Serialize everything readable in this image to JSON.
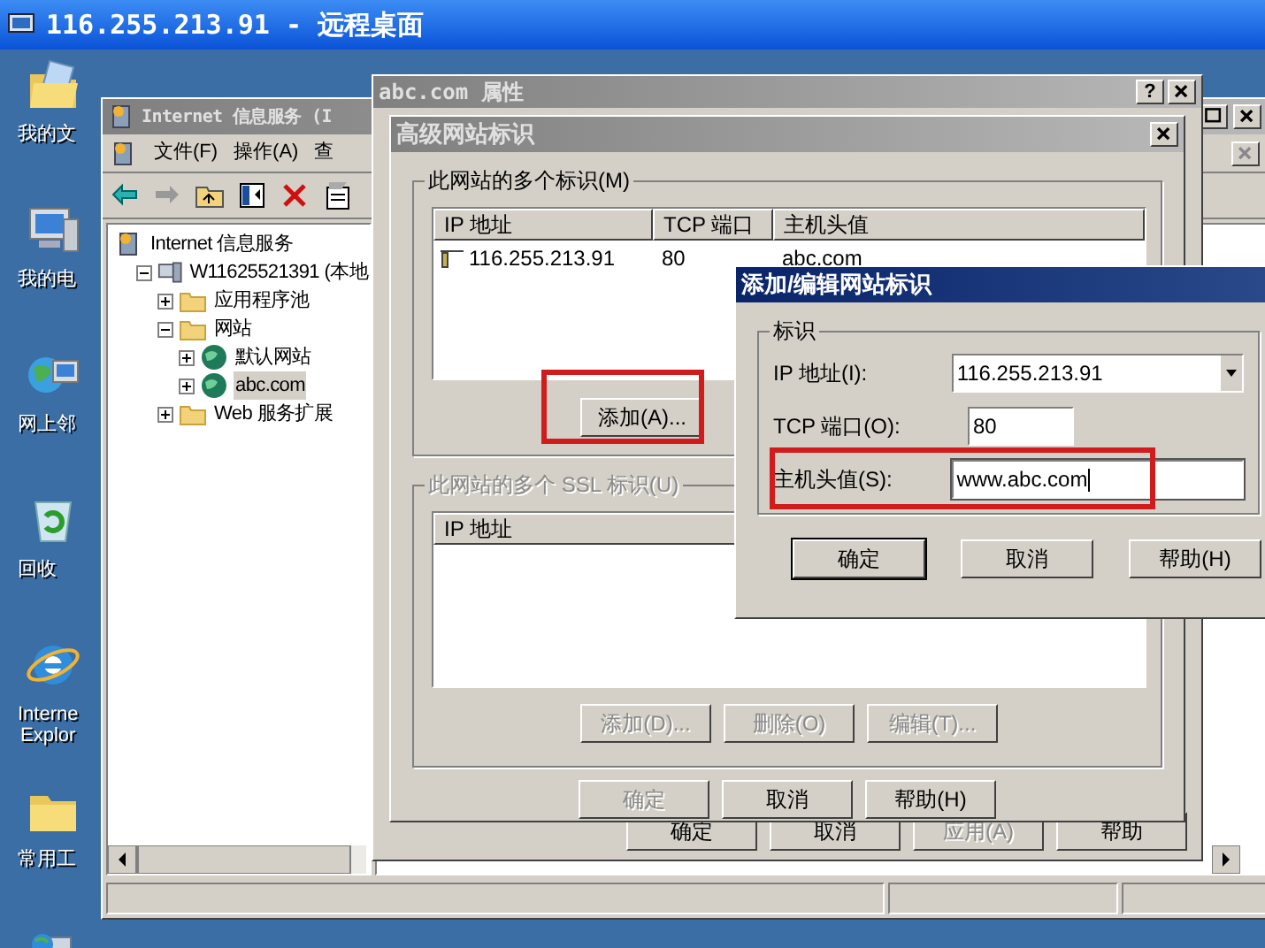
{
  "remote_window": {
    "title": "116.255.213.91 - 远程桌面"
  },
  "desktop_icons": [
    {
      "kind": "documents",
      "lines": [
        "我的文"
      ]
    },
    {
      "kind": "computer",
      "lines": [
        "我的电"
      ]
    },
    {
      "kind": "network",
      "lines": [
        "网上邻"
      ]
    },
    {
      "kind": "recycle",
      "lines": [
        "回收"
      ]
    },
    {
      "kind": "browser",
      "lines": [
        "Interne",
        "Explor"
      ]
    },
    {
      "kind": "folder",
      "lines": [
        "常用工"
      ]
    },
    {
      "kind": "network-app"
    }
  ],
  "iis_window": {
    "title": "Internet 信息服务 (I",
    "menu": [
      "文件(F)",
      "操作(A)",
      "查"
    ],
    "toolbar": [
      {
        "kind": "back"
      },
      {
        "kind": "forward"
      },
      {
        "kind": "up"
      },
      {
        "kind": "tree"
      },
      {
        "kind": "delete"
      },
      {
        "kind": "properties"
      }
    ],
    "tree": [
      {
        "label": "Internet 信息服务",
        "kind": "root",
        "selected": false,
        "children": [
          {
            "label": "W11625521391 (本地",
            "kind": "server",
            "expanded": true,
            "selected": false,
            "children": [
              {
                "label": "应用程序池",
                "kind": "folder",
                "expanded": false,
                "selected": false
              },
              {
                "label": "网站",
                "kind": "folder",
                "expanded": true,
                "selected": false,
                "children": [
                  {
                    "label": "默认网站",
                    "kind": "site",
                    "expanded": false,
                    "selected": false
                  },
                  {
                    "label": "abc.com",
                    "kind": "site",
                    "expanded": false,
                    "selected": true
                  }
                ]
              },
              {
                "label": "Web 服务扩展",
                "kind": "folder",
                "expanded": false,
                "selected": false
              }
            ]
          }
        ]
      }
    ]
  },
  "properties_dialog": {
    "title": "abc.com 属性",
    "help": "?",
    "buttons": [
      {
        "label": "确定",
        "disabled": false
      },
      {
        "label": "取消",
        "disabled": false
      },
      {
        "label": "应用(A)",
        "disabled": true
      },
      {
        "label": "帮助",
        "disabled": false
      }
    ]
  },
  "advanced_dialog": {
    "title": "高级网站标识",
    "identities": {
      "label": "此网站的多个标识(M)",
      "columns": [
        "IP 地址",
        "TCP 端口",
        "主机头值"
      ],
      "rows": [
        [
          "116.255.213.91",
          "80",
          "abc.com"
        ]
      ],
      "buttons": [
        {
          "label": "添加(A)...",
          "disabled": false,
          "highlighted": true
        }
      ]
    },
    "ssl_identities": {
      "label": "此网站的多个 SSL 标识(U)",
      "disabled": true,
      "columns": [
        "IP 地址"
      ],
      "buttons": [
        {
          "label": "添加(D)...",
          "disabled": true
        },
        {
          "label": "删除(O)",
          "disabled": true
        },
        {
          "label": "编辑(T)...",
          "disabled": true
        }
      ]
    },
    "buttons": [
      {
        "label": "确定",
        "disabled": true
      },
      {
        "label": "取消",
        "disabled": false
      },
      {
        "label": "帮助(H)",
        "disabled": false
      }
    ]
  },
  "add_dialog": {
    "title": "添加/编辑网站标识",
    "group": "标识",
    "fields": [
      {
        "label": "IP 地址(I):",
        "value": "116.255.213.91",
        "kind": "combo",
        "focused": false,
        "highlighted": false
      },
      {
        "label": "TCP 端口(O):",
        "value": "80",
        "kind": "text",
        "focused": false,
        "highlighted": false
      },
      {
        "label": "主机头值(S):",
        "value": "www.abc.com",
        "kind": "text",
        "focused": true,
        "highlighted": true
      }
    ],
    "buttons": [
      {
        "label": "确定",
        "default": true
      },
      {
        "label": "取消",
        "default": false
      },
      {
        "label": "帮助(H)",
        "default": false
      }
    ]
  }
}
